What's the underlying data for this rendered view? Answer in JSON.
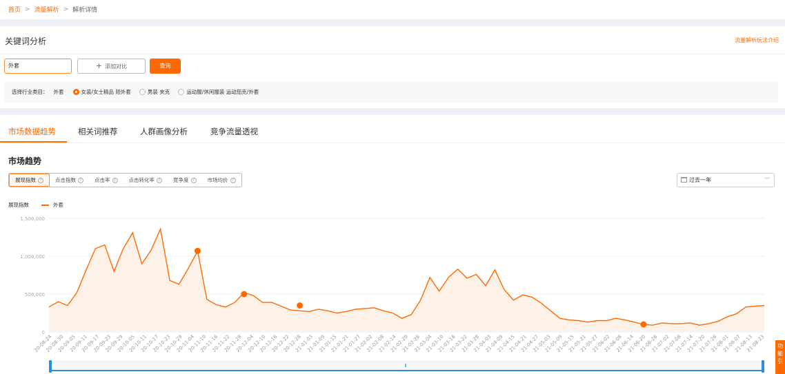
{
  "breadcrumb": {
    "home": "首页",
    "traffic": "流量解析",
    "current": "解析详情"
  },
  "keyword_card": {
    "title": "关键词分析",
    "guide_link": "流量解析玩法介绍",
    "keyword_value": "外套",
    "add_compare": "添加对比",
    "query": "查询",
    "category_label": "选择行业类目：",
    "category_current": "外套",
    "options": [
      "女装/女士精品 短外套",
      "男装 夹克",
      "运动服/休闲服装 运动茄克/外套"
    ],
    "selected_option": 0
  },
  "tabs": [
    "市场数据趋势",
    "相关词推荐",
    "人群画像分析",
    "竞争流量透视"
  ],
  "active_tab": 0,
  "section_title": "市场趋势",
  "metrics": [
    "展现指数",
    "点击指数",
    "点击率",
    "点击转化率",
    "竞争度",
    "市场均价"
  ],
  "active_metric": 0,
  "range": "过去一年",
  "legend": {
    "metric": "展现指数",
    "series": "外套"
  },
  "side_tab": "功能引",
  "colors": {
    "accent": "#ff6a00",
    "area": "#fdf1e8",
    "grid": "#eeeeee"
  },
  "chart_data": {
    "type": "area",
    "y_ticks": [
      "1,500,000",
      "1,000,000",
      "500,000",
      "0"
    ],
    "ylim": [
      0,
      1500000
    ],
    "x_ticks": [
      "20-08-24",
      "20-08-30",
      "20-09-05",
      "20-09-11",
      "20-09-17",
      "20-09-23",
      "20-09-29",
      "20-10-05",
      "20-10-11",
      "20-10-17",
      "20-10-23",
      "20-10-29",
      "20-11-04",
      "20-11-10",
      "20-11-16",
      "20-11-22",
      "20-11-28",
      "20-12-04",
      "20-12-10",
      "20-12-16",
      "20-12-22",
      "20-12-28",
      "21-01-03",
      "21-01-09",
      "21-01-15",
      "21-01-21",
      "21-01-27",
      "21-02-02",
      "21-02-08",
      "21-02-14",
      "21-02-20",
      "21-02-26",
      "21-03-04",
      "21-03-10",
      "21-03-16",
      "21-03-22",
      "21-03-28",
      "21-04-03",
      "21-04-09",
      "21-04-15",
      "21-04-21",
      "21-04-27",
      "21-05-03",
      "21-05-09",
      "21-05-15",
      "21-05-21",
      "21-05-27",
      "21-06-02",
      "21-06-08",
      "21-06-14",
      "21-06-20",
      "21-06-26",
      "21-07-02",
      "21-07-08",
      "21-07-14",
      "21-07-20",
      "21-07-26",
      "21-08-01",
      "21-08-07",
      "21-08-13",
      "21-08-23"
    ],
    "series": [
      {
        "values": [
          330000,
          400000,
          350000,
          520000,
          820000,
          1100000,
          1150000,
          800000,
          1100000,
          1310000,
          900000,
          1080000,
          1360000,
          680000,
          630000,
          840000,
          1070000,
          430000,
          360000,
          330000,
          390000,
          520000,
          480000,
          390000,
          390000,
          340000,
          290000,
          280000,
          270000,
          300000,
          280000,
          250000,
          270000,
          300000,
          310000,
          320000,
          280000,
          250000,
          180000,
          230000,
          420000,
          720000,
          540000,
          720000,
          830000,
          710000,
          760000,
          610000,
          820000,
          560000,
          420000,
          490000,
          460000,
          380000,
          280000,
          180000,
          160000,
          150000,
          130000,
          150000,
          150000,
          180000,
          160000,
          130000,
          100000,
          90000,
          120000,
          110000,
          110000,
          120000,
          90000,
          110000,
          140000,
          200000,
          240000,
          330000,
          340000,
          350000
        ],
        "markers": [
          {
            "index": 16,
            "value": 1070000
          },
          {
            "index": 21,
            "value": 500000
          },
          {
            "index": 27,
            "value": 350000
          },
          {
            "index": 64,
            "value": 100000
          }
        ]
      }
    ]
  }
}
